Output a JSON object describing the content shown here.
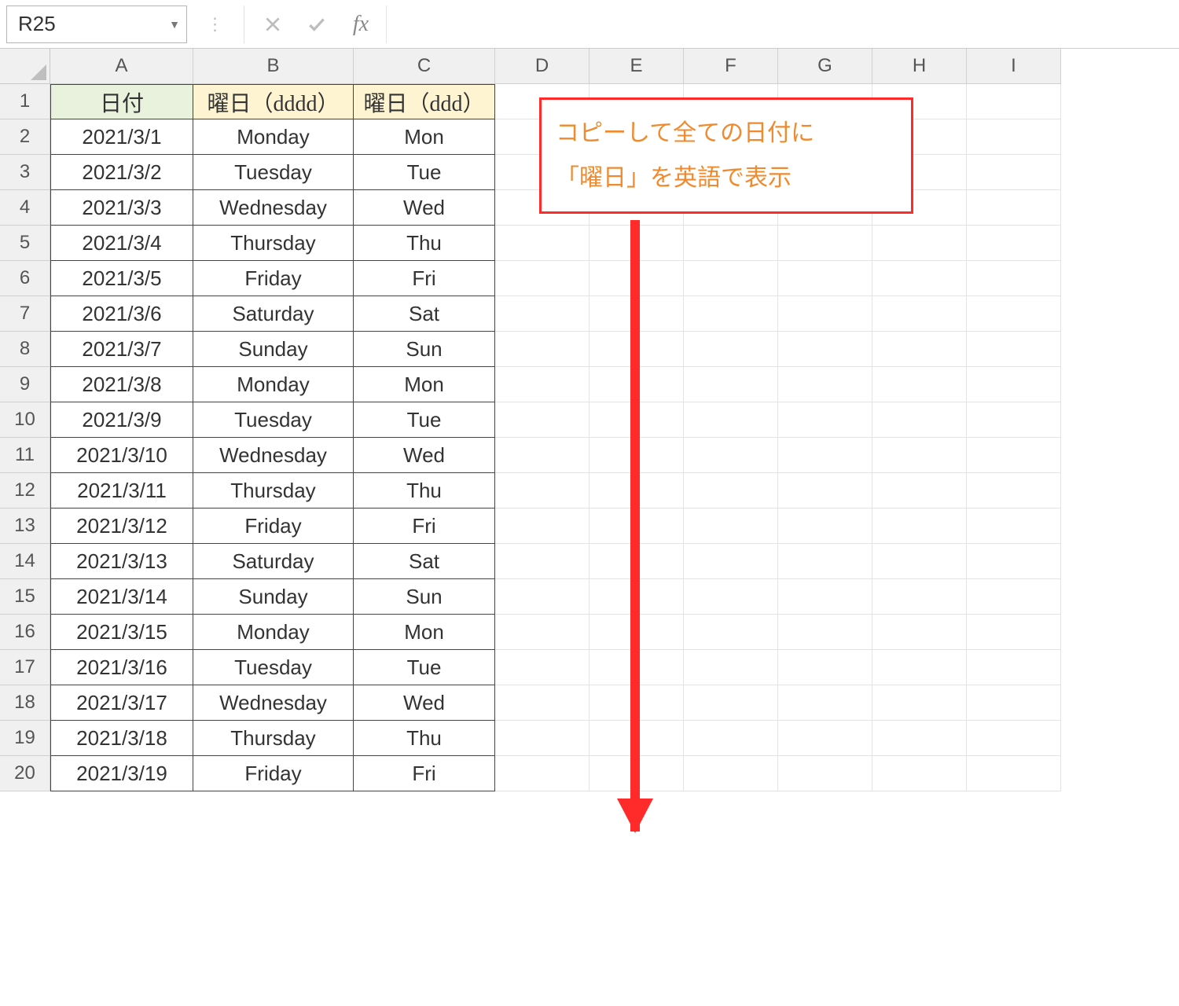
{
  "formula_bar": {
    "name_box": "R25",
    "fx_label": "fx",
    "input_value": ""
  },
  "columns": [
    "A",
    "B",
    "C",
    "D",
    "E",
    "F",
    "G",
    "H",
    "I"
  ],
  "row_numbers": [
    1,
    2,
    3,
    4,
    5,
    6,
    7,
    8,
    9,
    10,
    11,
    12,
    13,
    14,
    15,
    16,
    17,
    18,
    19,
    20
  ],
  "table": {
    "headers": {
      "a": "日付",
      "b": "曜日（dddd）",
      "c": "曜日（ddd）"
    },
    "rows": [
      {
        "a": "2021/3/1",
        "b": "Monday",
        "c": "Mon"
      },
      {
        "a": "2021/3/2",
        "b": "Tuesday",
        "c": "Tue"
      },
      {
        "a": "2021/3/3",
        "b": "Wednesday",
        "c": "Wed"
      },
      {
        "a": "2021/3/4",
        "b": "Thursday",
        "c": "Thu"
      },
      {
        "a": "2021/3/5",
        "b": "Friday",
        "c": "Fri"
      },
      {
        "a": "2021/3/6",
        "b": "Saturday",
        "c": "Sat"
      },
      {
        "a": "2021/3/7",
        "b": "Sunday",
        "c": "Sun"
      },
      {
        "a": "2021/3/8",
        "b": "Monday",
        "c": "Mon"
      },
      {
        "a": "2021/3/9",
        "b": "Tuesday",
        "c": "Tue"
      },
      {
        "a": "2021/3/10",
        "b": "Wednesday",
        "c": "Wed"
      },
      {
        "a": "2021/3/11",
        "b": "Thursday",
        "c": "Thu"
      },
      {
        "a": "2021/3/12",
        "b": "Friday",
        "c": "Fri"
      },
      {
        "a": "2021/3/13",
        "b": "Saturday",
        "c": "Sat"
      },
      {
        "a": "2021/3/14",
        "b": "Sunday",
        "c": "Sun"
      },
      {
        "a": "2021/3/15",
        "b": "Monday",
        "c": "Mon"
      },
      {
        "a": "2021/3/16",
        "b": "Tuesday",
        "c": "Tue"
      },
      {
        "a": "2021/3/17",
        "b": "Wednesday",
        "c": "Wed"
      },
      {
        "a": "2021/3/18",
        "b": "Thursday",
        "c": "Thu"
      },
      {
        "a": "2021/3/19",
        "b": "Friday",
        "c": "Fri"
      }
    ]
  },
  "annotation": {
    "line1": "コピーして全ての日付に",
    "line2": "「曜日」を英語で表示"
  }
}
